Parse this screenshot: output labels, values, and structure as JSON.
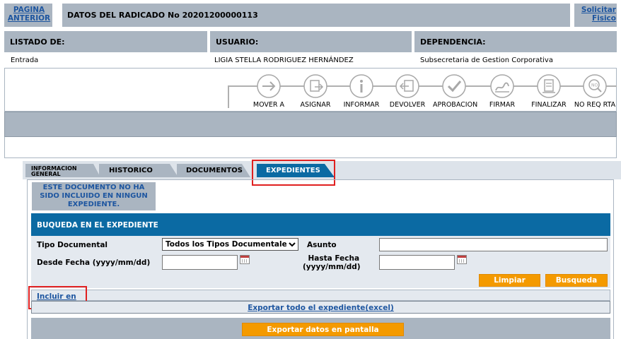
{
  "header": {
    "back_label": "PAGINA ANTERIOR",
    "title": "DATOS DEL RADICADO No 20201200000113",
    "physical_label": "Solicitar Fisico"
  },
  "info": {
    "listado_label": "LISTADO DE:",
    "usuario_label": "USUARIO:",
    "dependencia_label": "DEPENDENCIA:",
    "listado_value": "Entrada",
    "usuario_value": "LIGIA STELLA RODRIGUEZ HERNÁNDEZ",
    "dependencia_value": "Subsecretaria de Gestion Corporativa"
  },
  "toolbar": {
    "actions": [
      {
        "label": "MOVER A",
        "icon": "arrow-right-icon"
      },
      {
        "label": "ASIGNAR",
        "icon": "assign-icon"
      },
      {
        "label": "INFORMAR",
        "icon": "info-icon"
      },
      {
        "label": "DEVOLVER",
        "icon": "return-icon"
      },
      {
        "label": "APROBACION",
        "icon": "check-icon"
      },
      {
        "label": "FIRMAR",
        "icon": "sign-icon"
      },
      {
        "label": "FINALIZAR",
        "icon": "finish-icon"
      },
      {
        "label": "NO REQ RTA",
        "icon": "no-response-icon"
      }
    ]
  },
  "tabs": [
    {
      "label": "INFORMACION GENERAL",
      "line1": "INFORMACION",
      "line2": "GENERAL",
      "active": false
    },
    {
      "label": "HISTORICO",
      "active": false
    },
    {
      "label": "DOCUMENTOS",
      "active": false
    },
    {
      "label": "EXPEDIENTES",
      "active": true
    }
  ],
  "notice": "ESTE DOCUMENTO NO HA SIDO INCLUIDO EN NINGUN EXPEDIENTE.",
  "search": {
    "title": "BUQUEDA EN EL EXPEDIENTE",
    "tipo_label": "Tipo Documental",
    "tipo_selected": "Todos los Tipos Documentales",
    "asunto_label": "Asunto",
    "asunto_value": "",
    "desde_label": "Desde Fecha (yyyy/mm/dd)",
    "desde_value": "",
    "hasta_label_1": "Hasta Fecha",
    "hasta_label_2": "(yyyy/mm/dd)",
    "hasta_value": "",
    "clear_label": "Limpiar",
    "search_label": "Busqueda"
  },
  "include_link": "Incluir en",
  "export_all_link": "Exportar todo el expediente(excel)",
  "export_screen_label": "Exportar datos en pantalla",
  "colors": {
    "gray": "#aab5c1",
    "blue_bar": "#0b6aa3",
    "orange": "#f49a00",
    "highlight_red": "#e02020",
    "link_blue": "#1e56a0"
  }
}
